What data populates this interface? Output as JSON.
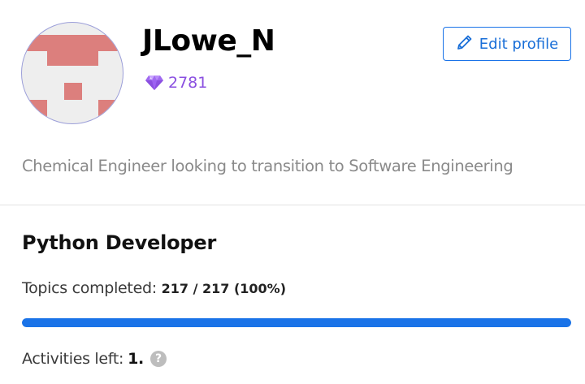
{
  "profile": {
    "username": "JLowe_N",
    "gems": "2781",
    "gem_icon": "gem-icon",
    "gem_color": "#8a4fe0",
    "edit_label": "Edit profile",
    "edit_icon": "pencil-icon",
    "bio": "Chemical Engineer looking to transition to Software Engineering",
    "avatar_colors": {
      "background": "#eeeeee",
      "pixels": "#dc7f7d"
    }
  },
  "track": {
    "title": "Python Developer",
    "topics_label": "Topics completed:",
    "topics_value": "217 / 217 (100%)",
    "progress_percent": 100,
    "progress_color": "#1a73e8",
    "activities_label": "Activities left:",
    "activities_value": "1.",
    "help_icon": "help-icon",
    "help_glyph": "?"
  }
}
